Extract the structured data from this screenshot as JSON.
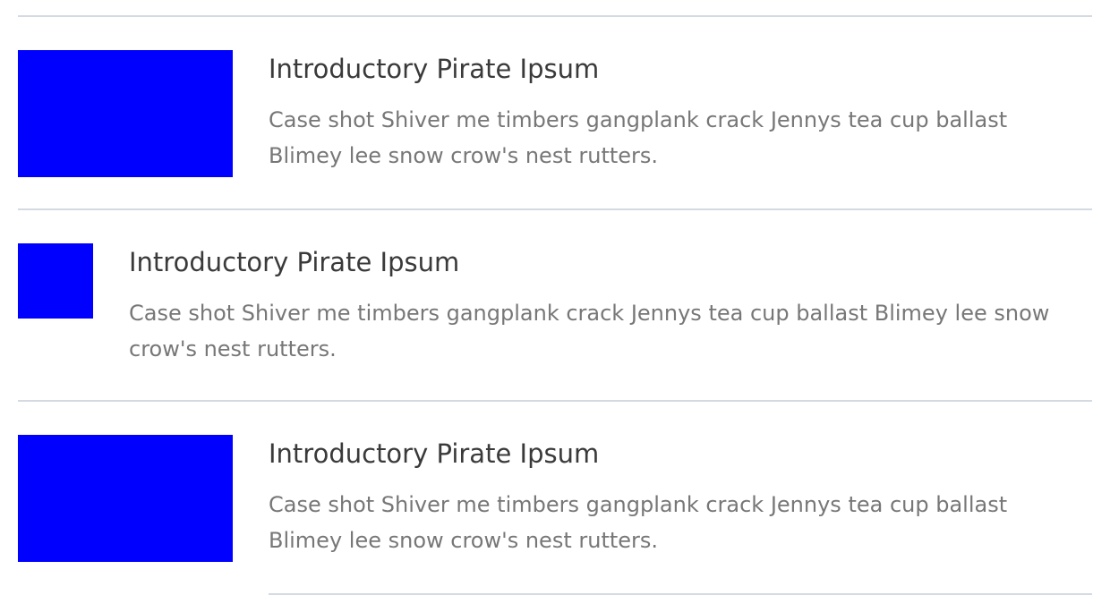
{
  "items": [
    {
      "title": "Introductory Pirate Ipsum",
      "description": "Case shot Shiver me timbers gangplank crack Jennys tea cup ballast Blimey lee snow crow's nest rutters."
    },
    {
      "title": "Introductory Pirate Ipsum",
      "description": "Case shot Shiver me timbers gangplank crack Jennys tea cup ballast Blimey lee snow crow's nest rutters."
    },
    {
      "title": "Introductory Pirate Ipsum",
      "description": "Case shot Shiver me timbers gangplank crack Jennys tea cup ballast Blimey lee snow crow's nest rutters."
    }
  ],
  "colors": {
    "thumbnail": "#0000ff",
    "divider": "#d3dae2",
    "title": "#3a3a3a",
    "description": "#777777"
  }
}
